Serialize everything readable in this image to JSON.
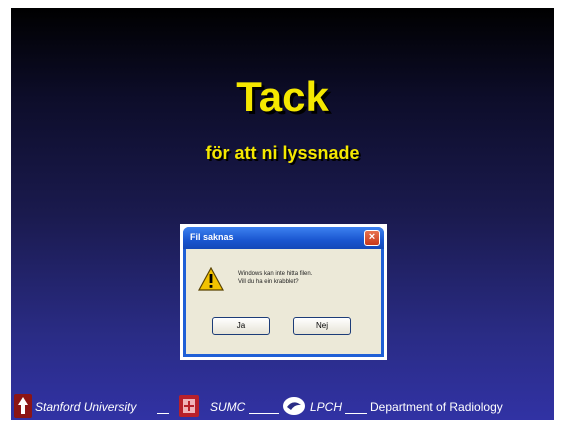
{
  "slide": {
    "title": "Tack",
    "subtitle": "för att ni lyssnade"
  },
  "dialog": {
    "title": "Fil saknas",
    "close_label": "×",
    "message_line1": "Windows kan inte hitta filen.",
    "message_line2": "Vill du ha ein krabblet?",
    "yes_label": "Ja",
    "no_label": "Nej"
  },
  "footer": {
    "stanford": "Stanford University",
    "sumc": "SUMC",
    "lpch": "LPCH",
    "department": "Department of Radiology"
  },
  "colors": {
    "title_yellow": "#f5e800",
    "xp_blue": "#1f5fd6",
    "dialog_body": "#ece9d8",
    "stanford_red": "#8c1515"
  },
  "icons": {
    "warning": "warning-triangle-icon",
    "stanford": "stanford-logo-icon",
    "sumc": "sumc-logo-icon",
    "lpch": "lpch-logo-icon"
  }
}
